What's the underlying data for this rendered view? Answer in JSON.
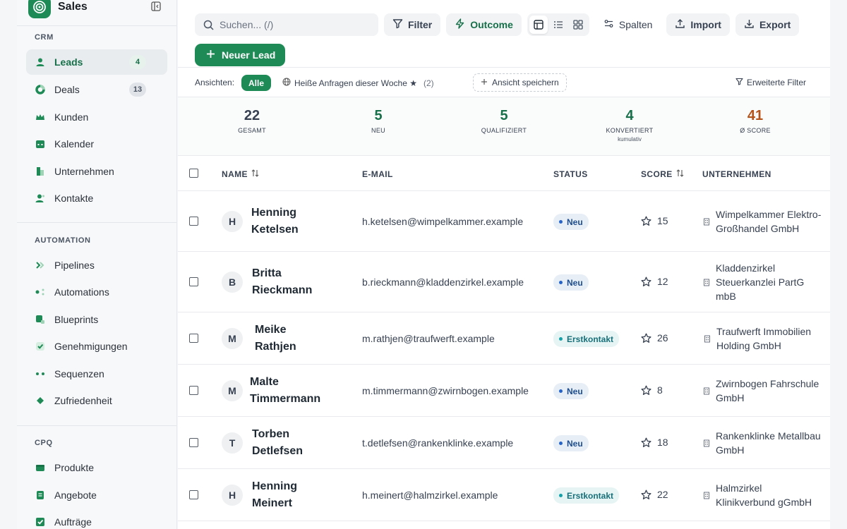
{
  "app": {
    "name": "Sales"
  },
  "sidebar": {
    "sections": [
      {
        "title": "CRM",
        "items": [
          {
            "label": "Leads",
            "count": "4",
            "icon": "user-icon",
            "active": true
          },
          {
            "label": "Deals",
            "count": "13",
            "icon": "donut-icon"
          },
          {
            "label": "Kunden",
            "icon": "crown-icon"
          },
          {
            "label": "Kalender",
            "icon": "calendar-icon"
          },
          {
            "label": "Unternehmen",
            "icon": "building-icon"
          },
          {
            "label": "Kontakte",
            "icon": "contact-icon"
          }
        ]
      },
      {
        "title": "AUTOMATION",
        "items": [
          {
            "label": "Pipelines",
            "icon": "chevrons-icon"
          },
          {
            "label": "Automations",
            "icon": "workflow-icon"
          },
          {
            "label": "Blueprints",
            "icon": "blueprint-icon"
          },
          {
            "label": "Genehmigungen",
            "icon": "check-square-icon"
          },
          {
            "label": "Sequenzen",
            "icon": "dots-icon"
          },
          {
            "label": "Zufriedenheit",
            "icon": "diamond-icon"
          }
        ]
      },
      {
        "title": "CPQ",
        "items": [
          {
            "label": "Produkte",
            "icon": "box-icon"
          },
          {
            "label": "Angebote",
            "icon": "document-icon"
          },
          {
            "label": "Aufträge",
            "icon": "order-icon"
          }
        ]
      }
    ]
  },
  "toolbar": {
    "search_placeholder": "Suchen... (/)",
    "filter": "Filter",
    "outcome": "Outcome",
    "columns": "Spalten",
    "import": "Import",
    "export": "Export",
    "new_lead": "Neuer Lead"
  },
  "views": {
    "label": "Ansichten:",
    "all": "Alle",
    "saved": "Heiße Anfragen dieser Woche ★",
    "saved_count": "(2)",
    "save_view": "Ansicht speichern",
    "advanced_filter": "Erweiterte Filter"
  },
  "stats": [
    {
      "value": "22",
      "label": "GESAMT",
      "color": "#374151"
    },
    {
      "value": "5",
      "label": "NEU",
      "color": "#17704a"
    },
    {
      "value": "5",
      "label": "QUALIFIZIERT",
      "color": "#17704a"
    },
    {
      "value": "4",
      "label": "KONVERTIERT",
      "sub": "kumulativ",
      "color": "#17704a"
    },
    {
      "value": "41",
      "label": "Ø SCORE",
      "color": "#b4541a"
    }
  ],
  "table": {
    "headers": {
      "name": "NAME",
      "email": "E-MAIL",
      "status": "STATUS",
      "score": "SCORE",
      "company": "UNTERNEHMEN"
    },
    "rows": [
      {
        "initial": "H",
        "first": "Henning",
        "last": "Ketelsen",
        "email": "h.ketelsen@wimpelkammer.example",
        "status": "Neu",
        "score": "15",
        "company": "Wimpelkammer Elektro-Großhandel GmbH"
      },
      {
        "initial": "B",
        "first": "Britta",
        "last": "Rieckmann",
        "email": "b.rieckmann@kladdenzirkel.example",
        "status": "Neu",
        "score": "12",
        "company": "Kladdenzirkel Steuerkanzlei PartG mbB"
      },
      {
        "initial": "M",
        "first": "Meike",
        "last": "Rathjen",
        "email": "m.rathjen@traufwerft.example",
        "status": "Erstkontakt",
        "score": "26",
        "company": "Traufwerft Immobilien Holding GmbH"
      },
      {
        "initial": "M",
        "first": "Malte",
        "last": "Timmermann",
        "email": "m.timmermann@zwirnbogen.example",
        "status": "Neu",
        "score": "8",
        "company": "Zwirnbogen Fahrschule GmbH"
      },
      {
        "initial": "T",
        "first": "Torben",
        "last": "Detlefsen",
        "email": "t.detlefsen@rankenklinke.example",
        "status": "Neu",
        "score": "18",
        "company": "Rankenklinke Metallbau GmbH"
      },
      {
        "initial": "H",
        "first": "Henning",
        "last": "Meinert",
        "email": "h.meinert@halmzirkel.example",
        "status": "Erstkontakt",
        "score": "22",
        "company": "Halmzirkel Klinikverbund gGmbH"
      }
    ]
  }
}
